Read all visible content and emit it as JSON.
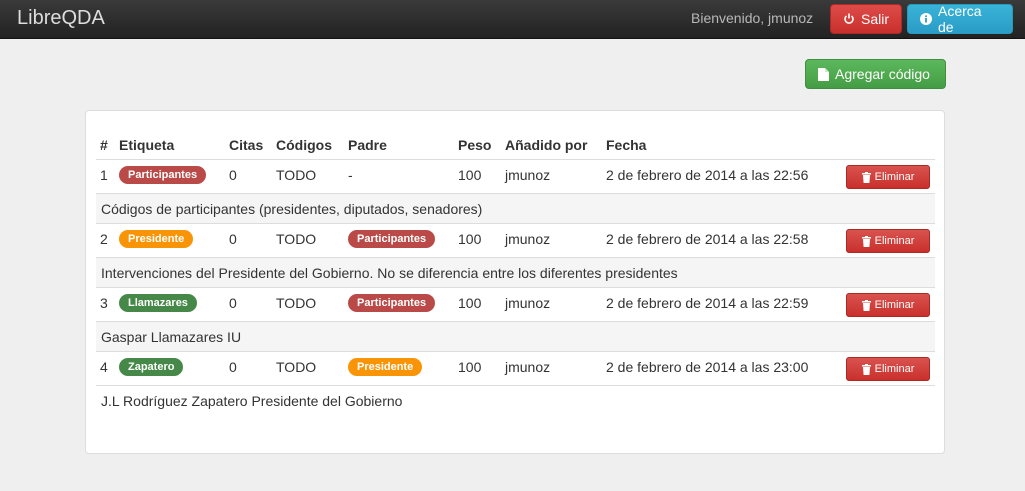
{
  "app": {
    "title": "LibreQDA"
  },
  "navbar": {
    "welcome": "Bienvenido, jmunoz",
    "logout_label": "Salir",
    "about_label": "Acerca de"
  },
  "toolbar": {
    "add_code_label": "Agregar código"
  },
  "table": {
    "headers": [
      "#",
      "Etiqueta",
      "Citas",
      "Códigos",
      "Padre",
      "Peso",
      "Añadido por",
      "Fecha"
    ],
    "delete_label": "Eliminar",
    "rows": [
      {
        "num": "1",
        "label": "Participantes",
        "label_color": "#b94a48",
        "citas": "0",
        "codigos": "TODO",
        "padre": "-",
        "padre_color": "",
        "peso": "100",
        "autor": "jmunoz",
        "fecha": "2 de febrero de 2014 a las 22:56",
        "descripcion": "Códigos de participantes (presidentes, diputados, senadores)"
      },
      {
        "num": "2",
        "label": "Presidente",
        "label_color": "#f89406",
        "citas": "0",
        "codigos": "TODO",
        "padre": "Participantes",
        "padre_color": "#b94a48",
        "peso": "100",
        "autor": "jmunoz",
        "fecha": "2 de febrero de 2014 a las 22:58",
        "descripcion": "Intervenciones del Presidente del Gobierno. No se diferencia entre los diferentes presidentes"
      },
      {
        "num": "3",
        "label": "Llamazares",
        "label_color": "#468847",
        "citas": "0",
        "codigos": "TODO",
        "padre": "Participantes",
        "padre_color": "#b94a48",
        "peso": "100",
        "autor": "jmunoz",
        "fecha": "2 de febrero de 2014 a las 22:59",
        "descripcion": "Gaspar Llamazares IU"
      },
      {
        "num": "4",
        "label": "Zapatero",
        "label_color": "#468847",
        "citas": "0",
        "codigos": "TODO",
        "padre": "Presidente",
        "padre_color": "#f89406",
        "peso": "100",
        "autor": "jmunoz",
        "fecha": "2 de febrero de 2014 a las 23:00",
        "descripcion": "J.L Rodríguez Zapatero Presidente del Gobierno"
      }
    ]
  },
  "icons": {
    "logout": "power-icon",
    "about": "info-icon",
    "add": "file-icon",
    "delete": "trash-icon"
  }
}
